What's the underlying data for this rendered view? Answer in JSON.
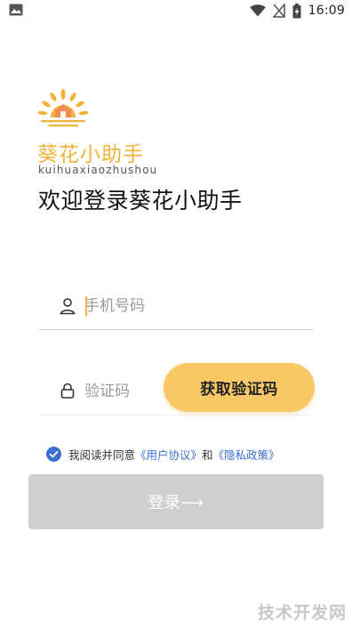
{
  "status_bar": {
    "time": "16:09",
    "icons": [
      "gallery-icon",
      "wifi-icon",
      "no-signal-icon",
      "battery-charging-icon"
    ]
  },
  "logo": {
    "name_cn": "葵花小助手",
    "name_en": "kuihuaxiaozhushou",
    "colors": {
      "petal": "#f2b33d",
      "house": "#ef8a52"
    }
  },
  "welcome": "欢迎登录葵花小助手",
  "phone_field": {
    "placeholder": "手机号码",
    "value": "",
    "icon": "user-icon"
  },
  "code_field": {
    "placeholder": "验证码",
    "value": "",
    "icon": "lock-icon"
  },
  "get_code_button": "获取验证码",
  "agreement": {
    "checked": true,
    "prefix": "我阅读并同意",
    "user_agreement": "《用户协议》",
    "and": "和",
    "privacy_policy": "《隐私政策》"
  },
  "login_button": "登录⟶",
  "watermark": "技术开发网",
  "colors": {
    "accent": "#f8c867",
    "link": "#3b6fd1",
    "checkbox": "#3b6fd1",
    "login_disabled": "#cfcfcf"
  }
}
